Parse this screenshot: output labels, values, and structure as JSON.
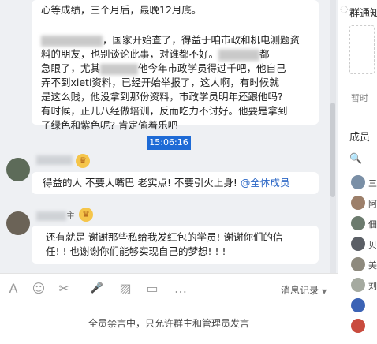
{
  "messages": {
    "msg1": {
      "line1": "心等成绩，三个月后，最晚12月底。",
      "line2": "，国家开始查了，得益于咱市政和机电测题资",
      "line3": "料的朋友，也别谈论此事，对谁都不好。",
      "line3_tail": "都",
      "line4a": "急眼了，尤其",
      "line4b": "他今年市政学员得过千吧，他自己",
      "line5": "弄不到xieti资料，已经开始举报了，这人啊，有时候就",
      "line6": "是这么贱，他没拿到那份资料，市政学员明年还跟他吗?",
      "line7": "有时候，正儿八经做培训，反而吃力不讨好。他要是拿到",
      "line8": "了绿色和紫色呢? 肯定偷着乐吧"
    },
    "timestamp": "15:06:16",
    "msg2": {
      "text": "得益的人 不要大嘴巴  老实点! 不要引火上身! ",
      "mention": "@全体成员"
    },
    "msg3": {
      "name_suffix": "主",
      "line1": "还有就是  谢谢那些私给我发红包的学员! 谢谢你们的信",
      "line2": "任! ! 也谢谢你们能够实现自己的梦想! ! !"
    }
  },
  "toolbar": {
    "font_icon": "A",
    "emoji_icon": "☺",
    "scissors_icon": "✂",
    "mic_icon": "🎤",
    "image_icon": "▨",
    "file_icon": "▭",
    "more_icon": "…",
    "history_label": "消息记录",
    "history_arrow": "▼"
  },
  "mute_notice": "全员禁言中，只允许群主和管理员发言",
  "right_panel": {
    "title": "群通知",
    "hint": "暂时",
    "members_title": "成员",
    "search_icon": "🔍",
    "members": [
      "三",
      "阿",
      "佃",
      "贝",
      "美",
      "刘"
    ]
  }
}
